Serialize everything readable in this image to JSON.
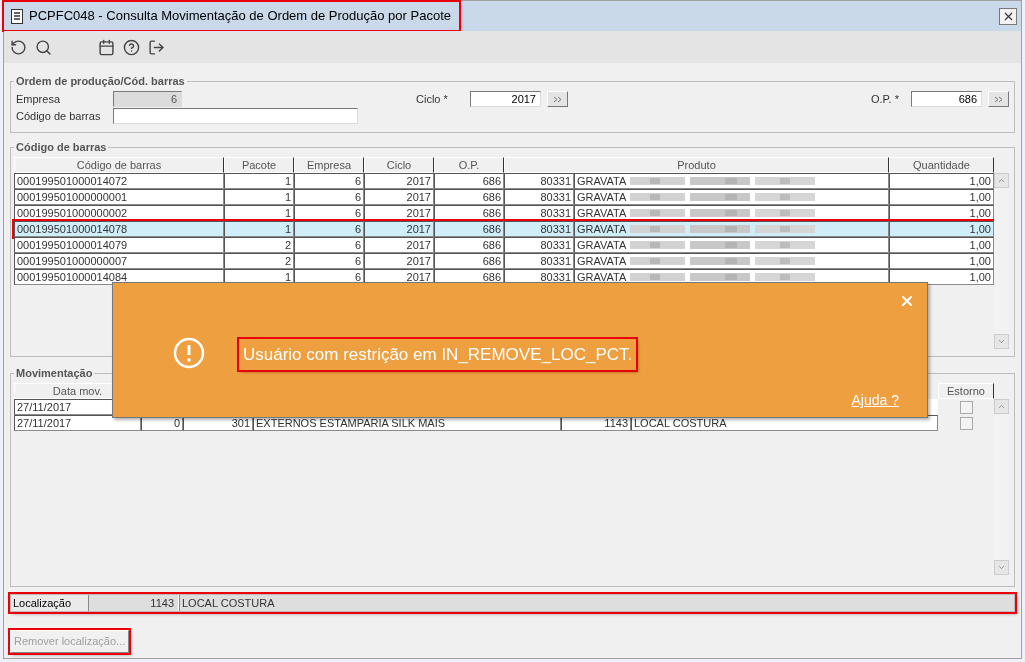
{
  "window": {
    "title": "PCPFC048 - Consulta Movimentação de Ordem de Produção por Pacote",
    "highlighted": true
  },
  "order_group": {
    "title": "Ordem de produção/Cód. barras",
    "company": {
      "label": "Empresa",
      "value": "6",
      "disabled": true
    },
    "barcode": {
      "label": "Código de barras"
    },
    "cycle": {
      "label": "Ciclo *",
      "value": "2017"
    },
    "op": {
      "label": "O.P. *",
      "value": "686"
    }
  },
  "barcode_table": {
    "title": "Código de barras",
    "columns": [
      "Código de barras",
      "Pacote",
      "Empresa",
      "Ciclo",
      "O.P.",
      "Produto",
      "Quantidade"
    ],
    "rows": [
      {
        "barcode": "000199501000014072",
        "package": "1",
        "company": "6",
        "cycle": "2017",
        "op": "686",
        "product_code": "80331",
        "product": "GRAVATA",
        "quantity": "1,00",
        "selected": false,
        "highlighted": false
      },
      {
        "barcode": "000199501000000001",
        "package": "1",
        "company": "6",
        "cycle": "2017",
        "op": "686",
        "product_code": "80331",
        "product": "GRAVATA",
        "quantity": "1,00",
        "selected": false,
        "highlighted": false
      },
      {
        "barcode": "000199501000000002",
        "package": "1",
        "company": "6",
        "cycle": "2017",
        "op": "686",
        "product_code": "80331",
        "product": "GRAVATA",
        "quantity": "1,00",
        "selected": false,
        "highlighted": false
      },
      {
        "barcode": "000199501000014078",
        "package": "1",
        "company": "6",
        "cycle": "2017",
        "op": "686",
        "product_code": "80331",
        "product": "GRAVATA",
        "quantity": "1,00",
        "selected": true,
        "highlighted": true
      },
      {
        "barcode": "000199501000014079",
        "package": "2",
        "company": "6",
        "cycle": "2017",
        "op": "686",
        "product_code": "80331",
        "product": "GRAVATA",
        "quantity": "1,00",
        "selected": false,
        "highlighted": false
      },
      {
        "barcode": "000199501000000007",
        "package": "2",
        "company": "6",
        "cycle": "2017",
        "op": "686",
        "product_code": "80331",
        "product": "GRAVATA",
        "quantity": "1,00",
        "selected": false,
        "highlighted": false
      },
      {
        "barcode": "000199501000014084",
        "package": "1",
        "company": "6",
        "cycle": "2017",
        "op": "686",
        "product_code": "80331",
        "product": "GRAVATA",
        "quantity": "1,00",
        "selected": false,
        "highlighted": false
      }
    ]
  },
  "movements": {
    "title": "Movimentação",
    "columns": {
      "date": "Data mov.",
      "reversal": "Estorno"
    },
    "rows": [
      {
        "date": "27/11/2017",
        "checked": false
      },
      {
        "date": "27/11/2017",
        "column_2": "0",
        "column_3": "301",
        "column_4": "EXTERNOS ESTAMPARIA SILK MAIS",
        "column_5": "1143",
        "column_6": "LOCAL COSTURA",
        "checked": false
      }
    ]
  },
  "location": {
    "label": "Localização",
    "code": "1143",
    "name": "LOCAL COSTURA",
    "highlighted": true
  },
  "remove_button": {
    "label": "Remover localização...",
    "disabled": true,
    "highlighted": true
  },
  "toast": {
    "message": "Usuário com restrição em IN_REMOVE_LOC_PCT.",
    "help_link": "Ajuda ?",
    "highlighted": true
  }
}
